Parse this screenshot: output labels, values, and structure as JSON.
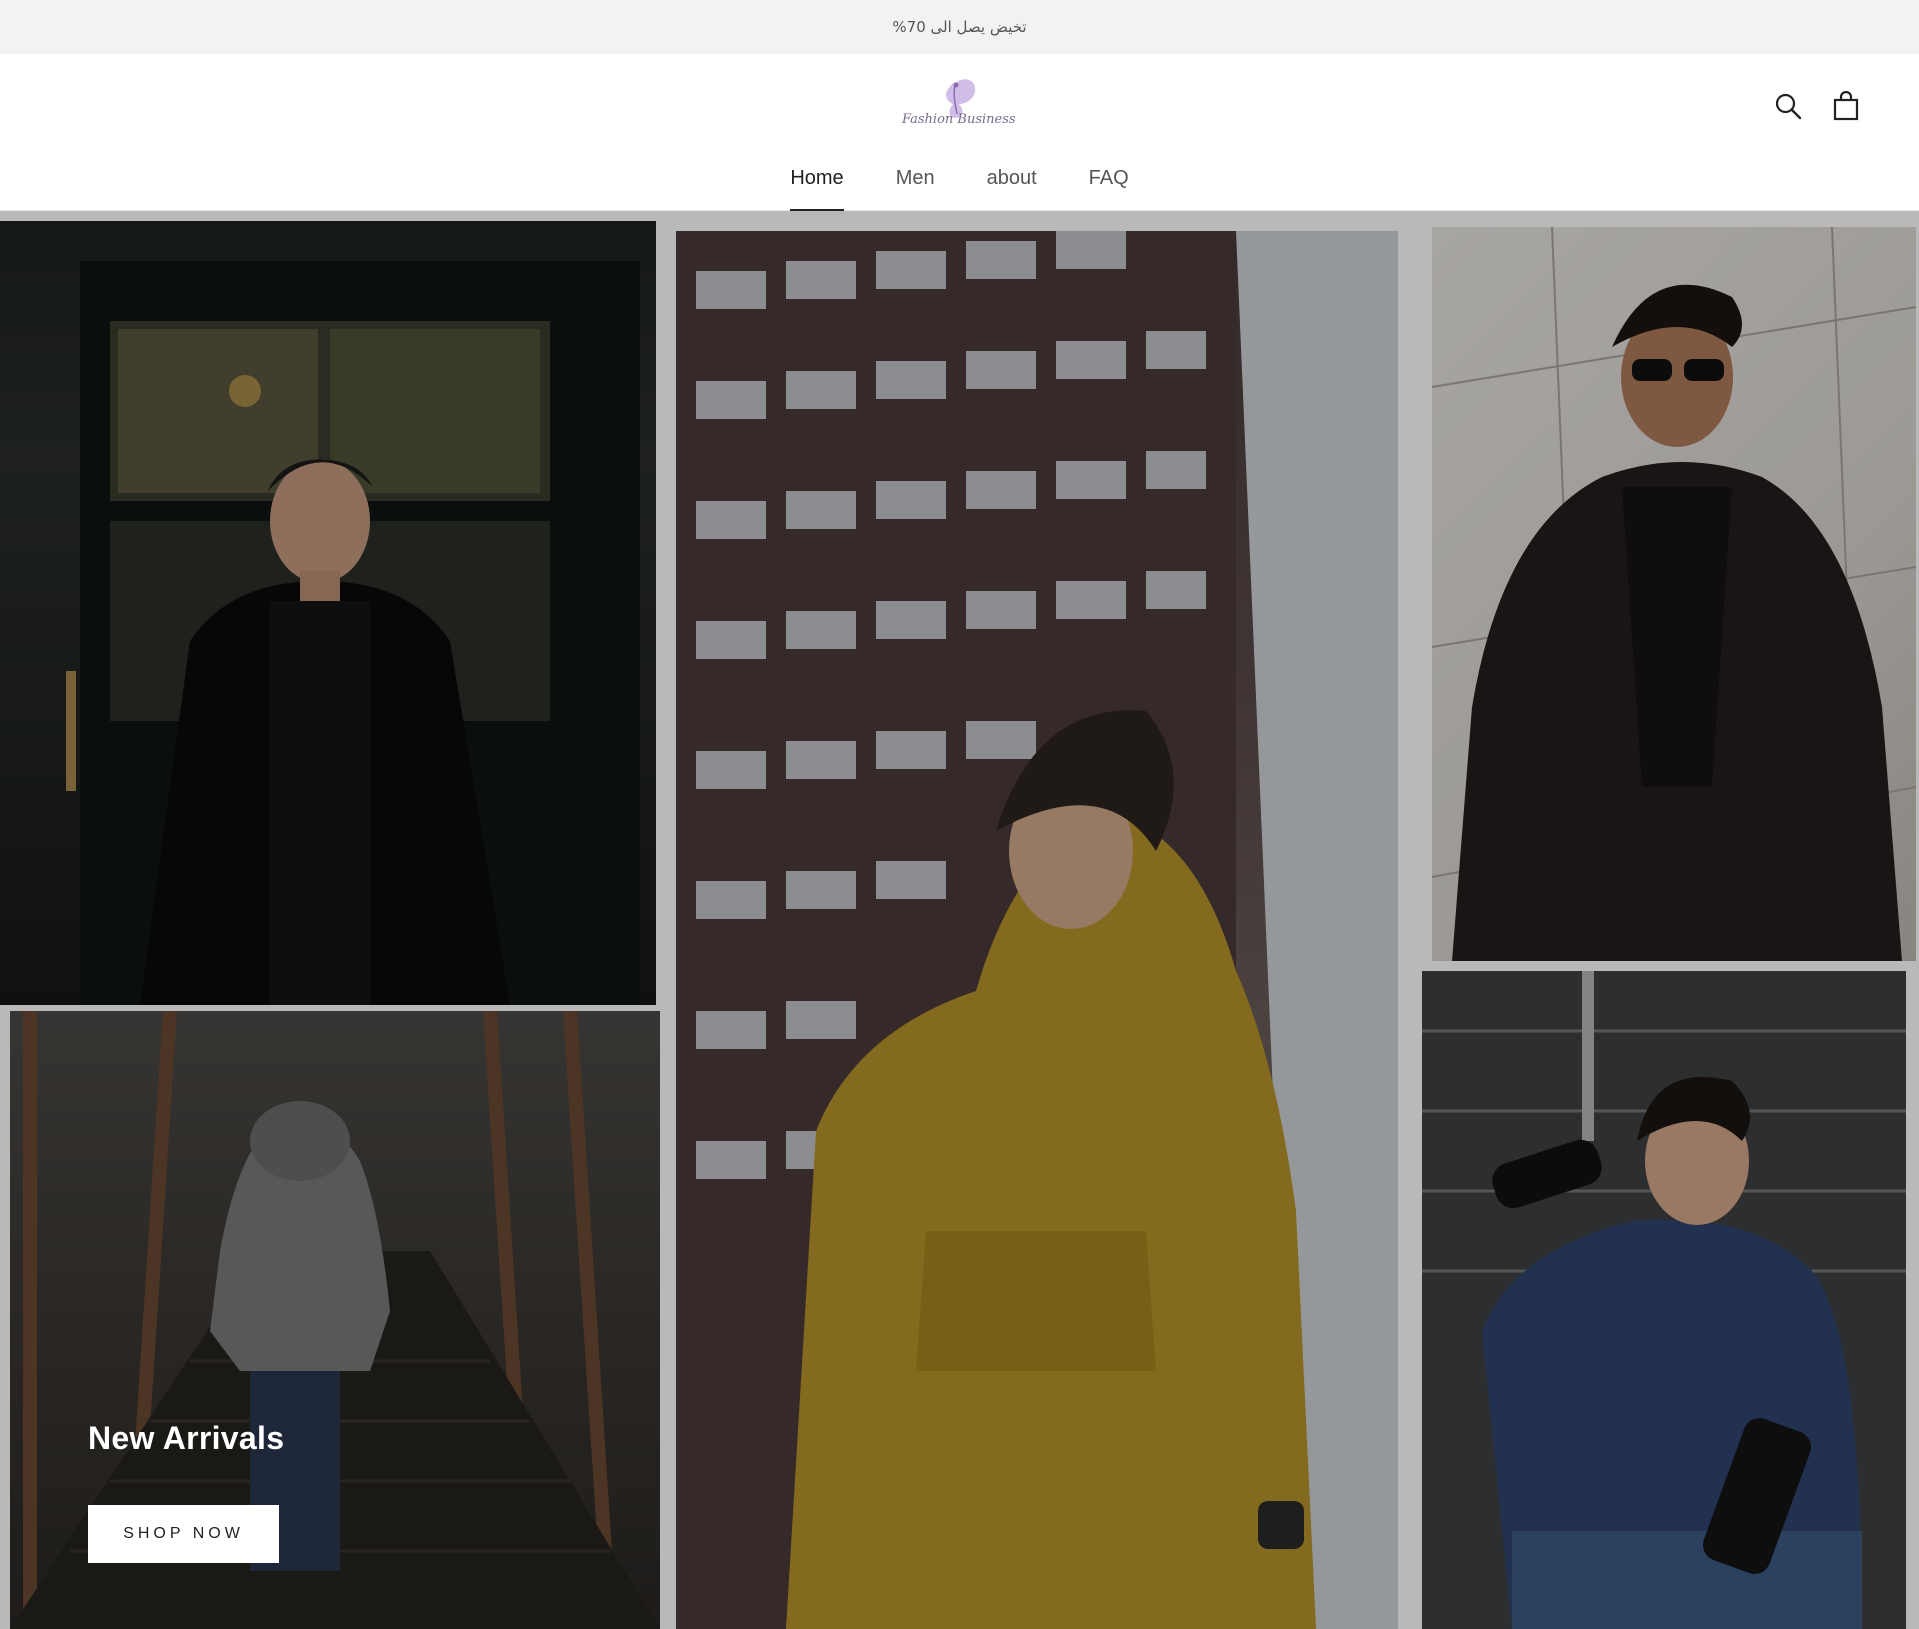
{
  "announcement": {
    "text": "تخيض يصل الى 70%"
  },
  "header": {
    "logo_text": "Fashion Business",
    "icons": {
      "search": "search-icon",
      "cart": "shopping-bag-icon"
    }
  },
  "nav": {
    "items": [
      {
        "label": "Home",
        "active": true
      },
      {
        "label": "Men",
        "active": false
      },
      {
        "label": "about",
        "active": false
      },
      {
        "label": "FAQ",
        "active": false
      }
    ]
  },
  "hero": {
    "title": "New Arrivals",
    "cta_label": "SHOP NOW"
  },
  "colors": {
    "announcement_bg": "#f2f2f2",
    "header_bg": "#ffffff",
    "nav_active": "#222222",
    "hoodie_yellow": "#b8932a",
    "logo_purple": "#b79bd3"
  }
}
